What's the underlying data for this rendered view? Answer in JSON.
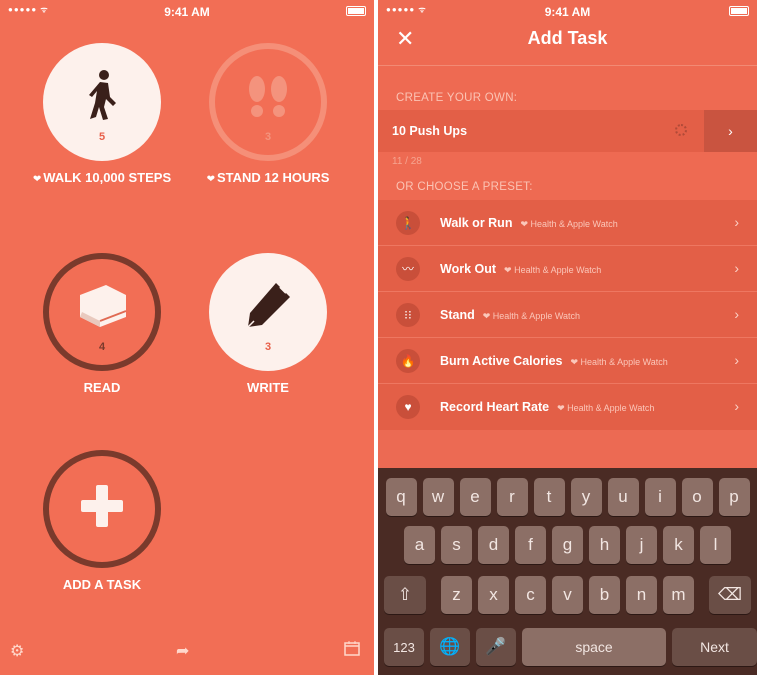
{
  "status": {
    "time": "9:41 AM",
    "signal": "●●●●● ᯤ"
  },
  "home": {
    "tasks": [
      {
        "label": "WALK 10,000 STEPS",
        "count": "5",
        "heart": true,
        "icon": "walking-person-icon"
      },
      {
        "label": "STAND 12 HOURS",
        "count": "3",
        "heart": true,
        "icon": "footprints-icon"
      },
      {
        "label": "READ",
        "count": "4",
        "heart": false,
        "icon": "book-icon"
      },
      {
        "label": "WRITE",
        "count": "3",
        "heart": false,
        "icon": "pen-icon"
      },
      {
        "label": "ADD A TASK",
        "count": "",
        "heart": false,
        "icon": "plus-icon"
      }
    ],
    "bottom_icons": [
      "settings-icon",
      "share-icon",
      "calendar-icon"
    ]
  },
  "add_task": {
    "title": "Add Task",
    "create_header": "CREATE YOUR OWN:",
    "custom_value": "10 Push Ups",
    "char_count": "11 / 28",
    "preset_header": "OR CHOOSE A PRESET:",
    "presets": [
      {
        "name": "Walk or Run",
        "source": "Health & Apple Watch",
        "icon": "walking-person-icon"
      },
      {
        "name": "Work Out",
        "source": "Health & Apple Watch",
        "icon": "workout-icon"
      },
      {
        "name": "Stand",
        "source": "Health & Apple Watch",
        "icon": "footprints-icon"
      },
      {
        "name": "Burn Active Calories",
        "source": "Health & Apple Watch",
        "icon": "flame-icon"
      },
      {
        "name": "Record Heart Rate",
        "source": "Health & Apple Watch",
        "icon": "heart-rate-icon"
      }
    ]
  },
  "keyboard": {
    "row1": [
      "q",
      "w",
      "e",
      "r",
      "t",
      "y",
      "u",
      "i",
      "o",
      "p"
    ],
    "row2": [
      "a",
      "s",
      "d",
      "f",
      "g",
      "h",
      "j",
      "k",
      "l"
    ],
    "row3": [
      "z",
      "x",
      "c",
      "v",
      "b",
      "n",
      "m"
    ],
    "num_key": "123",
    "space_key": "space",
    "next_key": "Next"
  },
  "colors": {
    "accent": "#f26e55",
    "keyboard_bg": "#4a2b24"
  }
}
